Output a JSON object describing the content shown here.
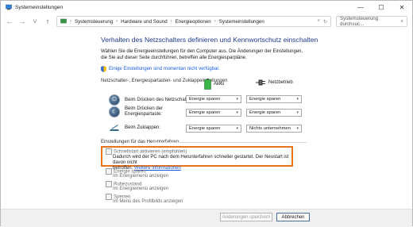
{
  "window": {
    "title": "Systemeinstellungen",
    "minimize": "—",
    "maximize": "☐",
    "close": "✕"
  },
  "nav": {
    "back": "←",
    "forward": "→",
    "dropdown": "˅",
    "up": "↑",
    "breadcrumb": [
      "Systemsteuerung",
      "Hardware und Sound",
      "Energieoptionen",
      "Systemeinstellungen"
    ],
    "search_placeholder": "Systemsteuerung durchsuc..."
  },
  "main": {
    "heading": "Verhalten des Netzschalters definieren und Kennwortschutz einschalten",
    "description": "Wählen Sie die Energieeinstellungen für den Computer aus. Die Änderungen der Einstellungen, die Sie auf dieser Seite durchführen, betreffen alle Energiesparpläne.",
    "unavailable_link": "Einige Einstellungen sind momentan nicht verfügbar.",
    "buttons_section": "Netzschalter-, Energiespartasten- und Zuklappeinstellungen",
    "col_battery": "Akku",
    "col_ac": "Netzbetrieb",
    "rows": [
      {
        "label": "Beim Drücken des Netzschalters:",
        "battery": "Energie sparen",
        "ac": "Energie sparen"
      },
      {
        "label": "Beim Drücken der Energiespartaste:",
        "battery": "Energie sparen",
        "ac": "Energie sparen"
      },
      {
        "label": "Beim Zuklappen:",
        "battery": "Energie sparen",
        "ac": "Nichts unternehmen"
      }
    ],
    "shutdown_section": "Einstellungen für das Herunterfahren",
    "fast_startup": {
      "label": "Schnellstart aktivieren (empfohlen)",
      "desc_line1": "Dadurch wird der PC nach dem Herunterfahren schneller gestartet. Der Neustart ist davon nicht",
      "desc_line2": "betroffen.",
      "more_info": "Weitere Informationen"
    },
    "options": [
      {
        "label": "Energie sparen",
        "sub": "Im Energiemenü anzeigen"
      },
      {
        "label": "Ruhezustand",
        "sub": "Im Energiemenü anzeigen"
      },
      {
        "label": "Sperren",
        "sub": "Im Menü des Profilbilds anzeigen"
      }
    ]
  },
  "footer": {
    "save": "Änderungen speichern",
    "cancel": "Abbrechen"
  },
  "colors": {
    "heading": "#1e3a8a",
    "link": "#1a5bd3",
    "highlight": "#e8731c",
    "battery": "#3bb44a"
  }
}
